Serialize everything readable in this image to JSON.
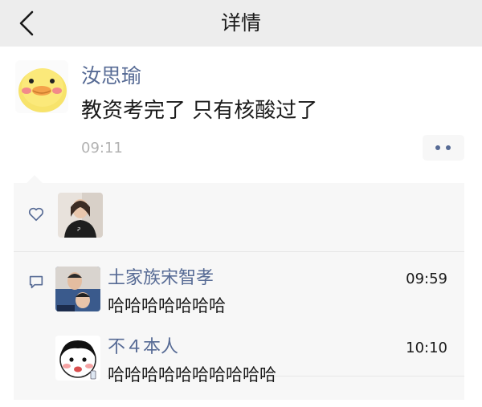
{
  "header": {
    "title": "详情",
    "back_icon": "chevron-left-icon"
  },
  "post": {
    "author": "汝思瑜",
    "content": "教资考完了 只有核酸过了",
    "time": "09:11",
    "more_icon": "more-dots-icon"
  },
  "likes": {
    "icon": "heart-icon",
    "users": [
      "liker"
    ]
  },
  "comments": [
    {
      "name": "土家族宋智孝",
      "time": "09:59",
      "text": "哈哈哈哈哈哈哈"
    },
    {
      "name": "不４本人",
      "time": "10:10",
      "text": "哈哈哈哈哈哈哈哈哈哈"
    }
  ],
  "colors": {
    "link_blue": "#576b95",
    "header_bg": "#ededed",
    "panel_bg": "#f7f7f7"
  }
}
